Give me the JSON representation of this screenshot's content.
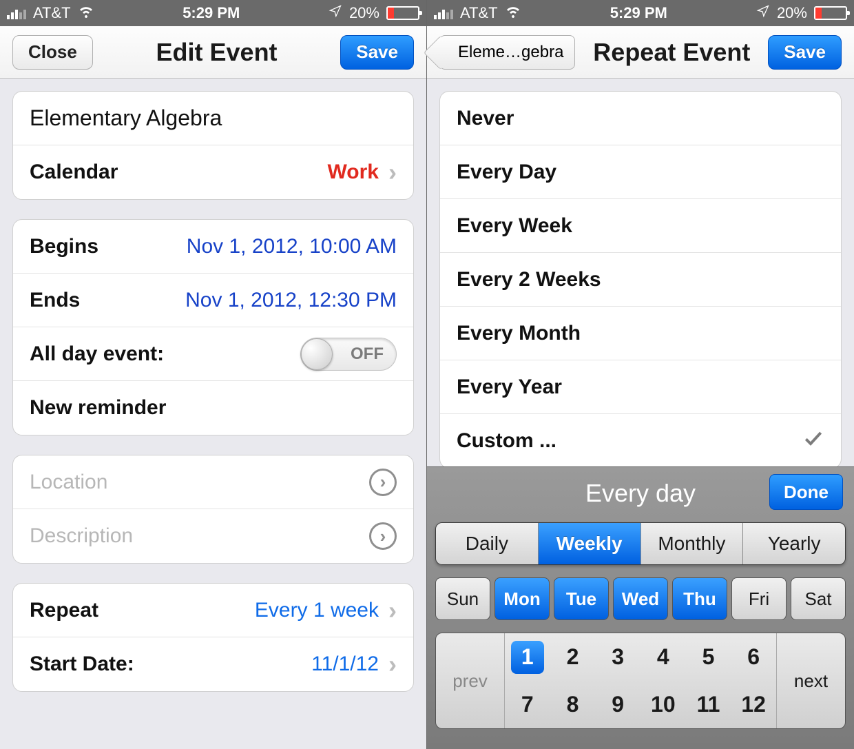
{
  "status": {
    "carrier": "AT&T",
    "time": "5:29 PM",
    "battery_pct": "20%"
  },
  "left": {
    "nav": {
      "close": "Close",
      "title": "Edit Event",
      "save": "Save"
    },
    "event_title": "Elementary Algebra",
    "calendar": {
      "label": "Calendar",
      "value": "Work"
    },
    "begins": {
      "label": "Begins",
      "value": "Nov 1, 2012, 10:00 AM"
    },
    "ends": {
      "label": "Ends",
      "value": "Nov 1, 2012, 12:30 PM"
    },
    "allday": {
      "label": "All day event:",
      "state": "OFF"
    },
    "new_reminder": "New reminder",
    "location_ph": "Location",
    "description_ph": "Description",
    "repeat": {
      "label": "Repeat",
      "value": "Every 1 week"
    },
    "start_date": {
      "label": "Start Date:",
      "value": "11/1/12"
    }
  },
  "right": {
    "nav": {
      "back": "Eleme…gebra",
      "title": "Repeat Event",
      "save": "Save"
    },
    "options": [
      "Never",
      "Every Day",
      "Every Week",
      "Every 2 Weeks",
      "Every Month",
      "Every Year",
      "Custom ..."
    ],
    "selected_index": 6,
    "picker": {
      "title": "Every day",
      "done": "Done",
      "freq": [
        "Daily",
        "Weekly",
        "Monthly",
        "Yearly"
      ],
      "freq_active": 1,
      "days": [
        "Sun",
        "Mon",
        "Tue",
        "Wed",
        "Thu",
        "Fri",
        "Sat"
      ],
      "days_active": [
        1,
        2,
        3,
        4
      ],
      "prev": "prev",
      "next": "next",
      "numbers_top": [
        "1",
        "2",
        "3",
        "4",
        "5",
        "6"
      ],
      "numbers_bot": [
        "7",
        "8",
        "9",
        "10",
        "11",
        "12"
      ],
      "num_active": "1"
    }
  }
}
